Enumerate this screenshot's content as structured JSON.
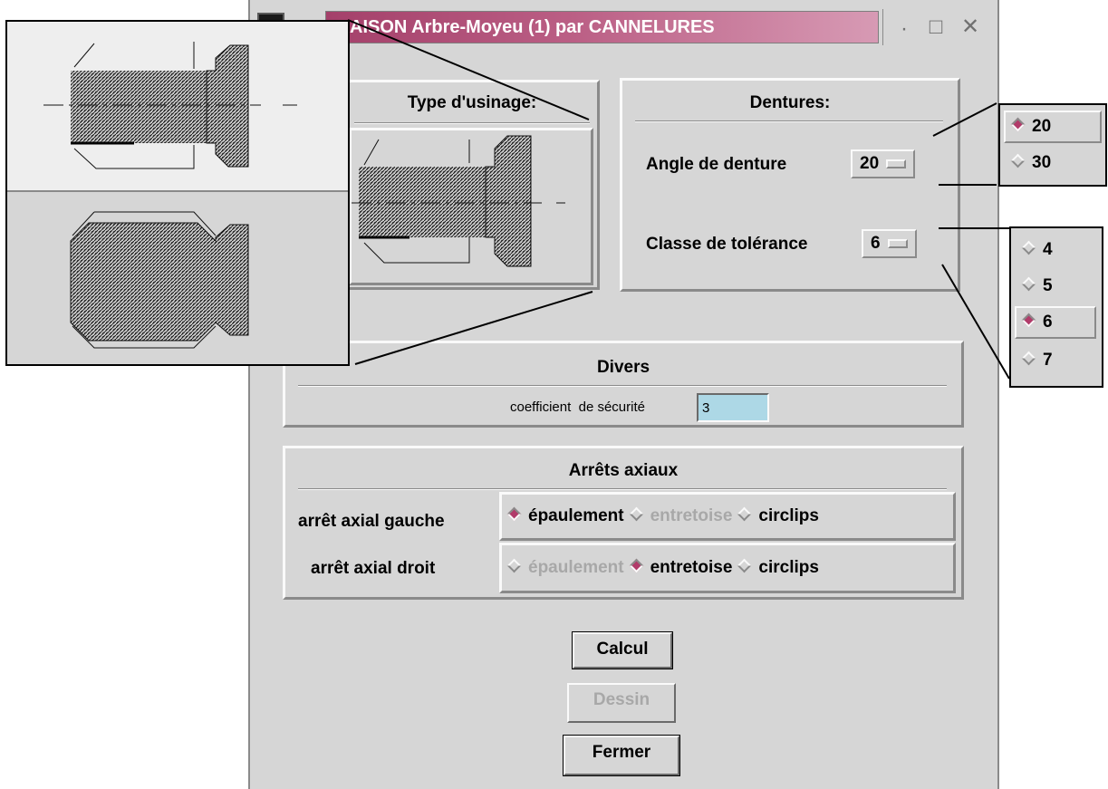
{
  "window": {
    "title": "AISON Arbre-Moyeu (1) par CANNELURES",
    "controls": [
      "·",
      "□",
      "✕"
    ]
  },
  "usinage": {
    "title": "Type d'usinage:"
  },
  "dentures": {
    "title": "Dentures:",
    "angle_label": "Angle de denture",
    "angle_value": "20",
    "tolerance_label": "Classe de tolérance",
    "tolerance_value": "6"
  },
  "angle_popup": {
    "options": [
      "20",
      "30"
    ],
    "selected": "20"
  },
  "tolerance_popup": {
    "options": [
      "4",
      "5",
      "6",
      "7"
    ],
    "selected": "6"
  },
  "divers": {
    "title": "Divers",
    "safety_label": "coefficient  de sécurité",
    "safety_value": "3"
  },
  "arrets": {
    "title": "Arrêts axiaux",
    "left_label": "arrêt axial gauche",
    "right_label": "arrêt axial droit",
    "left_options": [
      {
        "label": "épaulement",
        "selected": true,
        "disabled": false
      },
      {
        "label": "entretoise",
        "selected": false,
        "disabled": true
      },
      {
        "label": "circlips",
        "selected": false,
        "disabled": false
      }
    ],
    "right_options": [
      {
        "label": "épaulement",
        "selected": false,
        "disabled": true
      },
      {
        "label": "entretoise",
        "selected": true,
        "disabled": false
      },
      {
        "label": "circlips",
        "selected": false,
        "disabled": false
      }
    ]
  },
  "buttons": {
    "calcul": "Calcul",
    "dessin": "Dessin",
    "fermer": "Fermer"
  },
  "colors": {
    "accent": "#b23b6a",
    "panel": "#d6d6d6",
    "input_bg": "#add8e6"
  }
}
